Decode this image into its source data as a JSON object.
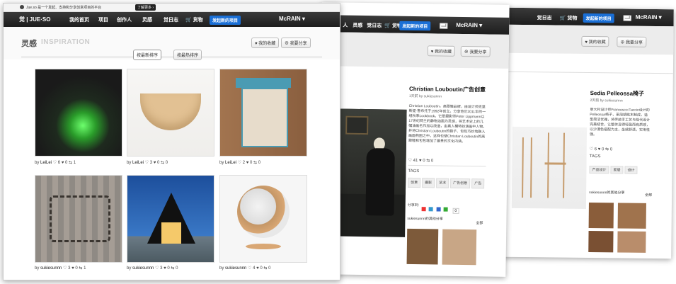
{
  "main": {
    "site_banner": "Jue.so 是一个发起、支持和分享创意项目的平台",
    "banner_more": "了解更多 ›",
    "logo": "觉 | JUE·SO",
    "nav": [
      "我的首页",
      "项目",
      "创作人",
      "灵感",
      "觉日志",
      "货物"
    ],
    "publish_button": "发起新的项目",
    "username": "McRAIN",
    "section_title": "灵感",
    "section_title_en": "INSPIRATION",
    "my_collect": "我的收藏",
    "share": "我要分享",
    "sort_new": "按最新排序",
    "sort_hot": "按最热排序",
    "tiles": [
      {
        "by": "by",
        "user": "LeiLei",
        "likes": "6",
        "comments": "0",
        "shares": "1"
      },
      {
        "by": "by",
        "user": "LeiLei",
        "likes": "3",
        "comments": "0",
        "shares": "0"
      },
      {
        "by": "by",
        "user": "LeiLei",
        "likes": "2",
        "comments": "0",
        "shares": "0"
      },
      {
        "by": "by",
        "user": "sukiesunnn",
        "likes": "3",
        "comments": "0",
        "shares": "1"
      },
      {
        "by": "by",
        "user": "sukiesunnn",
        "likes": "3",
        "comments": "0",
        "shares": "0"
      },
      {
        "by": "by",
        "user": "sukiesunnn",
        "likes": "4",
        "comments": "0",
        "shares": "0"
      }
    ]
  },
  "detail1": {
    "nav": [
      "人",
      "灵感",
      "觉日志",
      "货物"
    ],
    "publish_button": "发起新的项目",
    "username": "McRAIN",
    "my_collect": "我的收藏",
    "share": "我要分享",
    "title": "Christian Louboutin广告创意",
    "meta": "1天前 by sukiesunnn",
    "body": "Christian Louboutin，高跟鞋品牌，由设计师克里斯提·鲁布托于1992年创立。分享他们2011年的一组秋季Lookbook。它是摄影师Peter Lippmann以17世纪荷兰的静物油画为灵感，将艺术史上的几幅油画名作加以改造，由真人模特扮演画中人物，并将Christian Louboutin的鞋子、包包巧妙地融入画面构图之中，这样也使Christian Louboutin的高跟鞋和包包增加了最贵的文化内涵。",
    "likes": "41",
    "comments": "0",
    "shares": "0",
    "tags_label": "TAGS",
    "tags": [
      "创意",
      "摄影",
      "艺术",
      "广告创意",
      "广告"
    ],
    "share_to": "分享到:",
    "share_count": "0",
    "others": "sukiesunnn的其他分享",
    "all": "全部"
  },
  "detail2": {
    "nav": [
      "觉日志",
      "货物"
    ],
    "publish_button": "发起新的项目",
    "username": "McRAIN",
    "my_collect": "我的收藏",
    "share": "我要分享",
    "title": "Sedia Pelleossa椅子",
    "meta": "2天前 by sukiesunnn",
    "body": "意大利设计师Francesco Faccin设计的Pelleossa椅子，采用胡桃木制成，造型简洁优雅，将传统手工艺与现代设计完美结合，让整体显得轻盈而有质感，以沙漠色搭配为主，坐感舒适，实用性强。",
    "likes": "6",
    "comments": "0",
    "shares": "0",
    "tags_label": "TAGS",
    "tags": [
      "产品设计",
      "家居",
      "设计"
    ],
    "others": "sukiesunnn的其他分享",
    "all": "全部"
  }
}
